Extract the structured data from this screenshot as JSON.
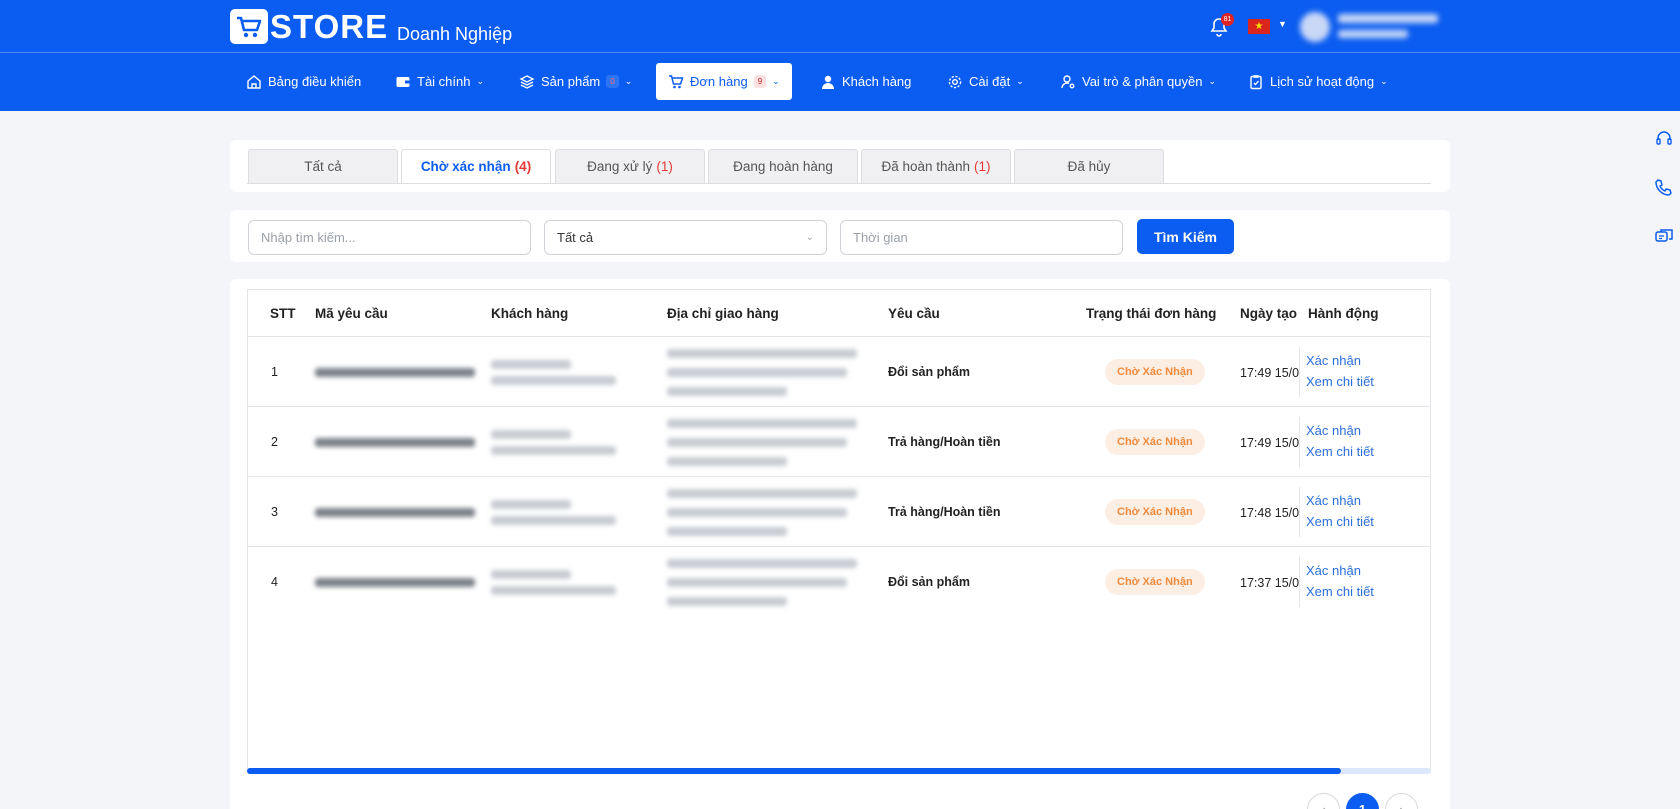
{
  "brand": {
    "logo_text": "STORE",
    "subtitle": "Doanh Nghiệp"
  },
  "topbar": {
    "notification_count": "81",
    "flag_star": "★",
    "language_caret": "▼"
  },
  "nav": [
    {
      "label": "Bảng điều khiển",
      "icon": "home-icon"
    },
    {
      "label": "Tài chính",
      "icon": "wallet-icon",
      "caret": "⌄"
    },
    {
      "label": "Sản phẩm",
      "icon": "layers-icon",
      "badge": "0",
      "caret": "⌄"
    },
    {
      "label": "Đơn hàng",
      "icon": "cart-icon",
      "badge": "9",
      "caret": "⌄",
      "active": true
    },
    {
      "label": "Khách hàng",
      "icon": "user-icon"
    },
    {
      "label": "Cài đặt",
      "icon": "gear-icon",
      "caret": "⌄"
    },
    {
      "label": "Vai trò & phân quyền",
      "icon": "user-key-icon",
      "caret": "⌄"
    },
    {
      "label": "Lịch sử hoạt động",
      "icon": "clipboard-icon",
      "caret": "⌄"
    }
  ],
  "tabs": [
    {
      "label": "Tất cả",
      "count": ""
    },
    {
      "label": "Chờ xác nhận",
      "count": "(4)",
      "active": true
    },
    {
      "label": "Đang xử lý",
      "count": "(1)"
    },
    {
      "label": "Đang hoàn hàng",
      "count": ""
    },
    {
      "label": "Đã hoàn thành",
      "count": "(1)"
    },
    {
      "label": "Đã hủy",
      "count": ""
    }
  ],
  "filters": {
    "search_placeholder": "Nhập tìm kiếm...",
    "status_value": "Tất cả",
    "status_chevron": "⌄",
    "time_placeholder": "Thời gian",
    "search_button": "Tìm Kiếm"
  },
  "table": {
    "columns": [
      "STT",
      "Mã yêu cầu",
      "Khách hàng",
      "Địa chỉ giao hàng",
      "Yêu cầu",
      "Trạng thái đơn hàng",
      "Ngày tạo",
      "Hành động"
    ],
    "rows": [
      {
        "stt": "1",
        "request": "Đổi sản phẩm",
        "status": "Chờ Xác Nhận",
        "date": "17:49 15/0",
        "action_confirm": "Xác nhận",
        "action_detail": "Xem chi tiết"
      },
      {
        "stt": "2",
        "request": "Trả hàng/Hoàn tiền",
        "status": "Chờ Xác Nhận",
        "date": "17:49 15/0",
        "action_confirm": "Xác nhận",
        "action_detail": "Xem chi tiết"
      },
      {
        "stt": "3",
        "request": "Trả hàng/Hoàn tiền",
        "status": "Chờ Xác Nhận",
        "date": "17:48 15/0",
        "action_confirm": "Xác nhận",
        "action_detail": "Xem chi tiết"
      },
      {
        "stt": "4",
        "request": "Đổi sản phẩm",
        "status": "Chờ Xác Nhận",
        "date": "17:37 15/0",
        "action_confirm": "Xác nhận",
        "action_detail": "Xem chi tiết"
      }
    ],
    "horizontal_scroll_position": 0.93
  },
  "pagination": {
    "prev": "‹",
    "current": "1",
    "next": "›"
  },
  "colors": {
    "primary": "#0b5cf0",
    "status_badge_bg": "#fdeee3",
    "status_badge_text": "#f08a3c",
    "count_red": "#e53935"
  }
}
